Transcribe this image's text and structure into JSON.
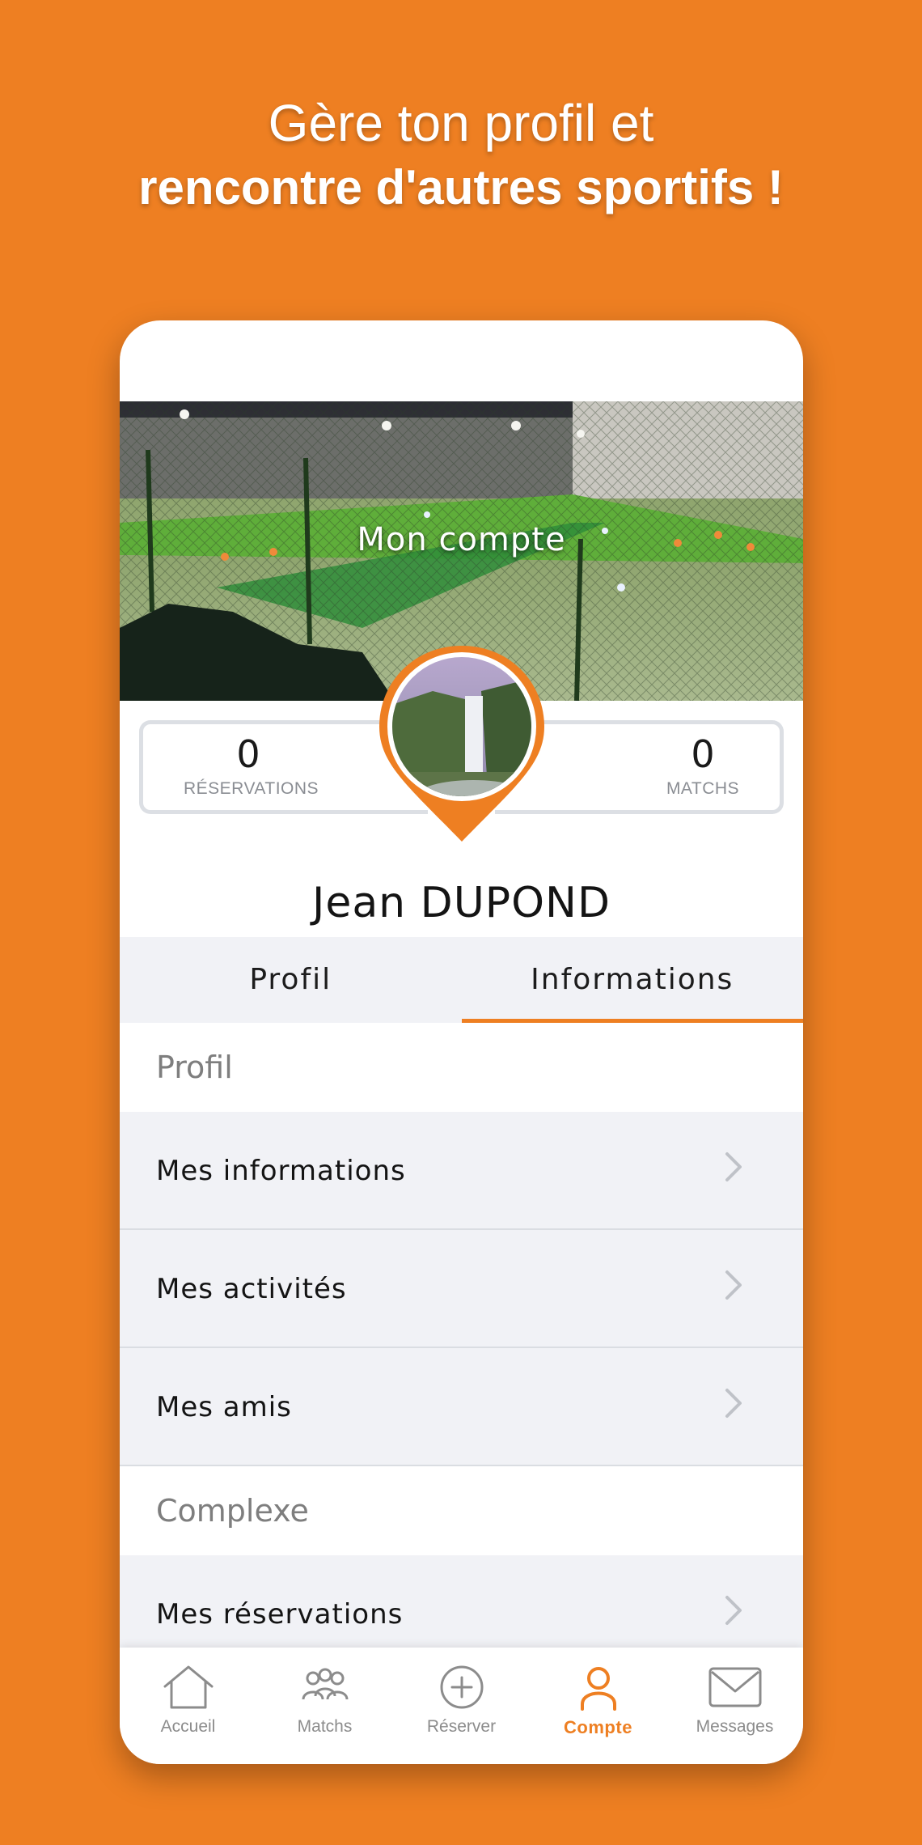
{
  "headline": {
    "line1": "Gère ton profil et",
    "line2": "rencontre d'autres sportifs !"
  },
  "colors": {
    "accent": "#ee7f22",
    "background": "#ee7f22",
    "panel": "#f1f2f6"
  },
  "header": {
    "title": "Mon compte"
  },
  "stats": {
    "reservations": {
      "value": "0",
      "label": "RÉSERVATIONS"
    },
    "matchs": {
      "value": "0",
      "label": "MATCHS"
    }
  },
  "user": {
    "first_name": "Jean",
    "last_name": "DUPOND"
  },
  "tabs": [
    {
      "label": "Profil",
      "active": false
    },
    {
      "label": "Informations",
      "active": true
    }
  ],
  "sections": [
    {
      "title": "Profil",
      "items": [
        {
          "label": "Mes informations",
          "icon": "chevron-right-icon"
        },
        {
          "label": "Mes activités",
          "icon": "chevron-right-icon"
        },
        {
          "label": "Mes amis",
          "icon": "chevron-right-icon"
        }
      ]
    },
    {
      "title": "Complexe",
      "items": [
        {
          "label": "Mes réservations",
          "icon": "chevron-right-icon"
        }
      ]
    }
  ],
  "bottom_nav": [
    {
      "label": "Accueil",
      "icon": "home-icon",
      "active": false
    },
    {
      "label": "Matchs",
      "icon": "players-icon",
      "active": false
    },
    {
      "label": "Réserver",
      "icon": "plus-circle-icon",
      "active": false
    },
    {
      "label": "Compte",
      "icon": "user-icon",
      "active": true
    },
    {
      "label": "Messages",
      "icon": "envelope-icon",
      "active": false
    }
  ]
}
